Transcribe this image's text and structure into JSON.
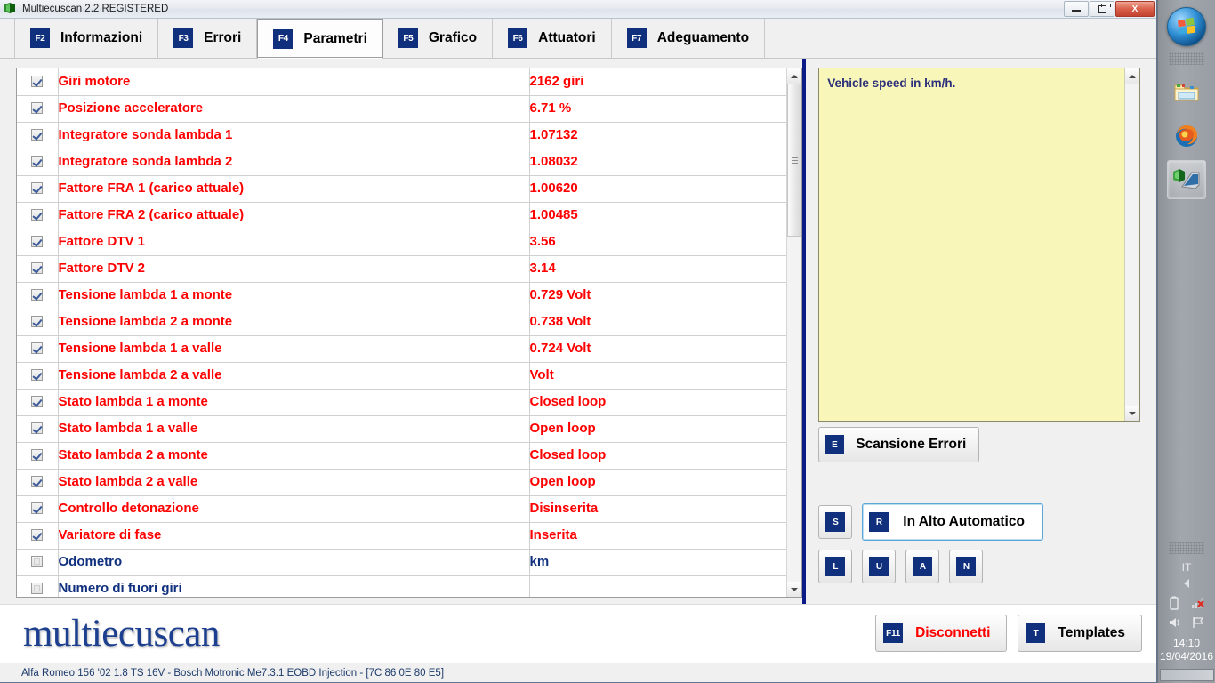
{
  "window": {
    "title": "Multiecuscan 2.2 REGISTERED",
    "icon": "multiecuscan-app-icon",
    "minimize_label": "Minimize",
    "restore_label": "Restore",
    "close_label": "X"
  },
  "tabs": [
    {
      "key": "F2",
      "label": "Informazioni",
      "active": false
    },
    {
      "key": "F3",
      "label": "Errori",
      "active": false
    },
    {
      "key": "F4",
      "label": "Parametri",
      "active": true
    },
    {
      "key": "F5",
      "label": "Grafico",
      "active": false
    },
    {
      "key": "F6",
      "label": "Attuatori",
      "active": false
    },
    {
      "key": "F7",
      "label": "Adeguamento",
      "active": false
    }
  ],
  "table": {
    "rows": [
      {
        "checked": true,
        "name": "Giri motore",
        "value": "2162 giri"
      },
      {
        "checked": true,
        "name": "Posizione acceleratore",
        "value": "6.71 %"
      },
      {
        "checked": true,
        "name": "Integratore sonda lambda 1",
        "value": "1.07132"
      },
      {
        "checked": true,
        "name": "Integratore sonda lambda 2",
        "value": "1.08032"
      },
      {
        "checked": true,
        "name": "Fattore FRA 1 (carico attuale)",
        "value": "1.00620"
      },
      {
        "checked": true,
        "name": "Fattore FRA 2 (carico attuale)",
        "value": "1.00485"
      },
      {
        "checked": true,
        "name": "Fattore DTV 1",
        "value": "3.56"
      },
      {
        "checked": true,
        "name": "Fattore DTV 2",
        "value": "3.14"
      },
      {
        "checked": true,
        "name": "Tensione lambda 1 a monte",
        "value": "0.729 Volt"
      },
      {
        "checked": true,
        "name": "Tensione lambda 2 a monte",
        "value": "0.738 Volt"
      },
      {
        "checked": true,
        "name": "Tensione lambda 1 a valle",
        "value": "0.724 Volt"
      },
      {
        "checked": true,
        "name": "Tensione lambda 2 a valle",
        "value": " Volt"
      },
      {
        "checked": true,
        "name": "Stato lambda 1 a monte",
        "value": "Closed loop"
      },
      {
        "checked": true,
        "name": "Stato lambda 1 a valle",
        "value": "Open loop"
      },
      {
        "checked": true,
        "name": "Stato lambda 2 a monte",
        "value": "Closed loop"
      },
      {
        "checked": true,
        "name": "Stato lambda 2 a valle",
        "value": "Open loop"
      },
      {
        "checked": true,
        "name": "Controllo detonazione",
        "value": "Disinserita"
      },
      {
        "checked": true,
        "name": "Variatore di fase",
        "value": "Inserita"
      },
      {
        "checked": false,
        "name": "Odometro",
        "value": " km"
      },
      {
        "checked": false,
        "name": "Numero di fuori giri",
        "value": ""
      }
    ]
  },
  "tooltip": {
    "text": "Vehicle speed in km/h."
  },
  "side_buttons": {
    "scan": {
      "key": "E",
      "label": "Scansione Errori"
    },
    "s": {
      "key": "S",
      "label": ""
    },
    "auto": {
      "key": "R",
      "label": "In Alto Automatico"
    },
    "l": {
      "key": "L",
      "label": ""
    },
    "u": {
      "key": "U",
      "label": ""
    },
    "a": {
      "key": "A",
      "label": ""
    },
    "n": {
      "key": "N",
      "label": ""
    }
  },
  "footer_buttons": {
    "disconnect": {
      "key": "F11",
      "label": "Disconnetti"
    },
    "templates": {
      "key": "T",
      "label": "Templates"
    }
  },
  "branding": {
    "logo": "multiecuscan"
  },
  "statusbar": {
    "text": "Alfa Romeo 156 '02 1.8 TS 16V - Bosch Motronic Me7.3.1 EOBD Injection - [7C 86 0E 80 E5]"
  },
  "taskbar": {
    "start": "windows-start-orb",
    "items": [
      {
        "icon": "folder-explorer-icon",
        "active": false
      },
      {
        "icon": "firefox-icon",
        "active": false
      },
      {
        "icon": "multiecuscan-taskbar-icon",
        "active": true
      }
    ],
    "tray": {
      "language": "IT",
      "icons": [
        "battery-icon",
        "network-disconnected-icon",
        "volume-icon",
        "action-center-flag-icon"
      ],
      "time": "14:10",
      "date": "19/04/2016"
    }
  },
  "colors": {
    "accent_blue": "#10307e",
    "panel_border_blue": "#0b1a86",
    "value_red": "#ff0000",
    "inactive_blue": "#10307e",
    "tooltip_yellow": "#f8f6b8",
    "logo_blue": "#1d3f8f"
  }
}
